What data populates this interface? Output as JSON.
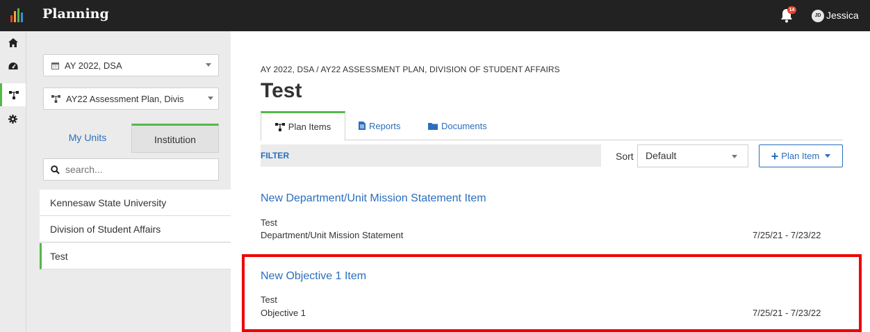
{
  "header": {
    "app_title": "Planning",
    "notification_count": "14",
    "user_initials": "JD",
    "user_name": "Jessica"
  },
  "rail": {
    "items": [
      {
        "icon": "home-icon"
      },
      {
        "icon": "dashboard-icon"
      },
      {
        "icon": "plan-tree-icon",
        "active": true
      },
      {
        "icon": "settings-icon"
      }
    ]
  },
  "panel": {
    "year_select": "AY 2022, DSA",
    "plan_select": "AY22 Assessment Plan, Divis",
    "tab_my_units": "My Units",
    "tab_institution": "Institution",
    "search_placeholder": "search...",
    "units": [
      {
        "label": "Kennesaw State University"
      },
      {
        "label": "Division of Student Affairs"
      },
      {
        "label": "Test",
        "active": true
      }
    ]
  },
  "main": {
    "breadcrumb": "AY 2022, DSA / AY22 ASSESSMENT PLAN, DIVISION OF STUDENT AFFAIRS",
    "title": "Test",
    "tabs": [
      {
        "label": "Plan Items",
        "active": true
      },
      {
        "label": "Reports"
      },
      {
        "label": "Documents"
      }
    ],
    "filter_label": "FILTER",
    "sort_label": "Sort",
    "sort_value": "Default",
    "add_button": "Plan Item",
    "items": [
      {
        "title": "New Department/Unit Mission Statement Item",
        "unit": "Test",
        "type": "Department/Unit Mission Statement",
        "dates": "7/25/21 - 7/23/22"
      },
      {
        "title": "New Objective 1 Item",
        "unit": "Test",
        "type": "Objective 1",
        "dates": "7/25/21 - 7/23/22"
      }
    ]
  },
  "colors": {
    "topbar": "#222222",
    "accent_green": "#53b848",
    "link_blue": "#2a6ebd",
    "highlight_red": "#ee0000",
    "badge_red": "#e8412c"
  }
}
